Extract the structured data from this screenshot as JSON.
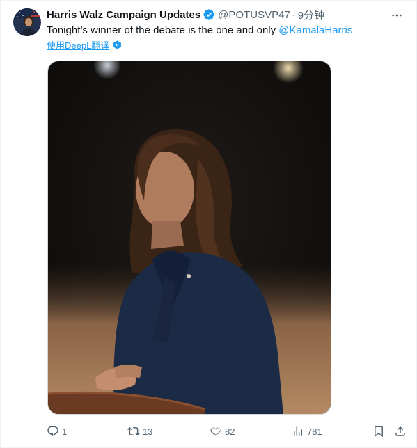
{
  "tweet": {
    "author_name": "Harris Walz Campaign Updates",
    "handle": "@POTUSVP47",
    "separator": "·",
    "time": "9分钟",
    "text_prefix": "Tonight’s winner of the debate is the one and only ",
    "mention": "@KamalaHarris",
    "translate_label": "使用DeepL翻译",
    "more_label": "···"
  },
  "actions": {
    "reply_count": "1",
    "retweet_count": "13",
    "like_count": "82",
    "views_count": "781"
  },
  "colors": {
    "accent": "#1d9bf0",
    "text": "#0f1419",
    "secondary": "#536471"
  },
  "icons": [
    "verified-badge-icon",
    "more-icon",
    "translate-icon",
    "reply-icon",
    "retweet-icon",
    "like-icon",
    "views-icon",
    "bookmark-icon",
    "share-icon"
  ]
}
